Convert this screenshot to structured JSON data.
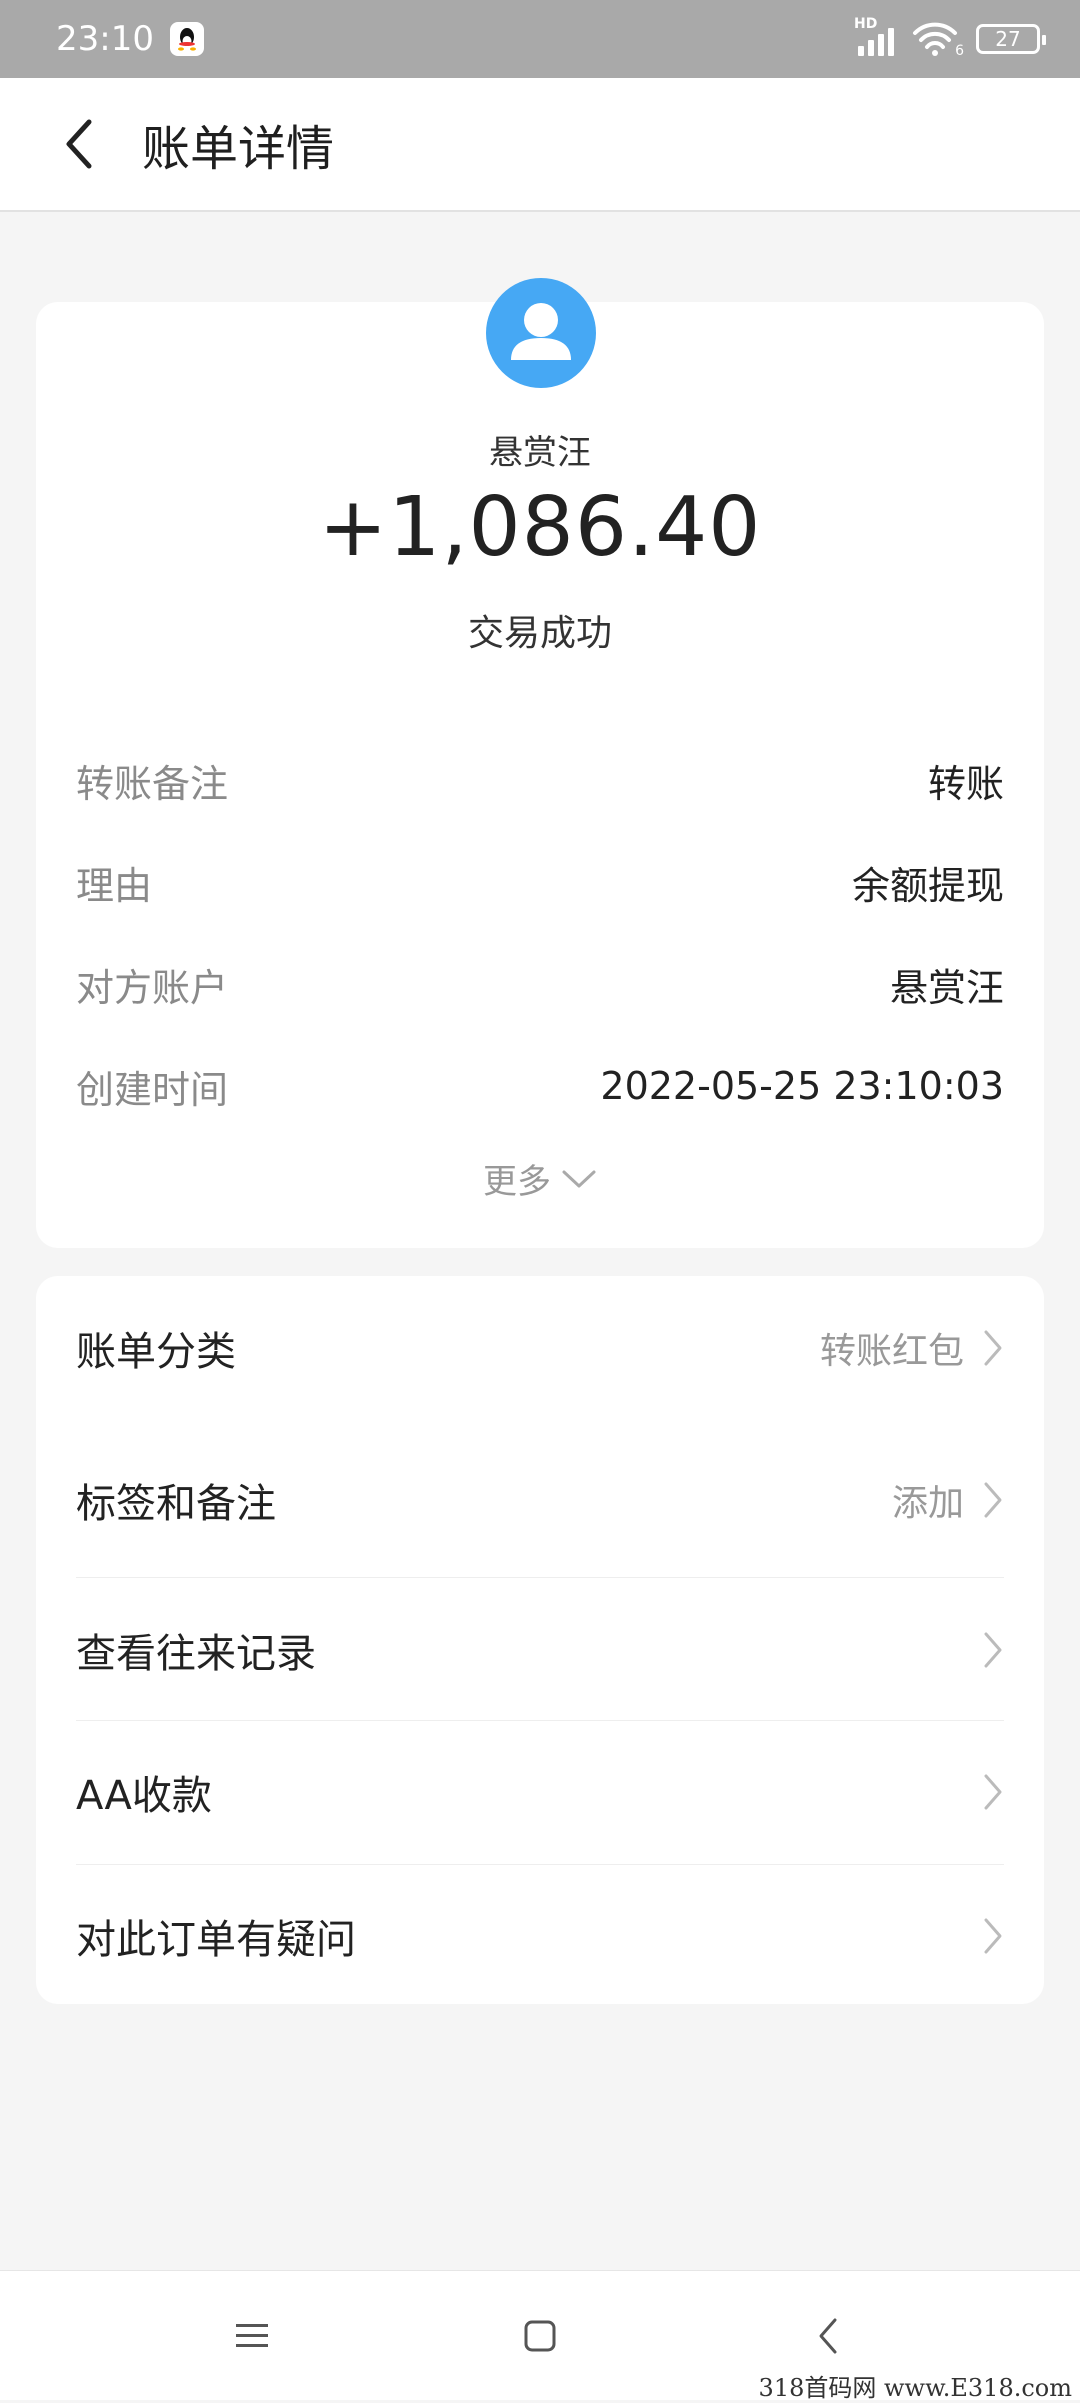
{
  "status_bar": {
    "time": "23:10",
    "network_label": "HD",
    "wifi_sub": "6",
    "battery": "27"
  },
  "header": {
    "title": "账单详情"
  },
  "summary": {
    "payee": "悬赏汪",
    "amount": "+1,086.40",
    "status": "交易成功"
  },
  "details": [
    {
      "label": "转账备注",
      "value": "转账"
    },
    {
      "label": "理由",
      "value": "余额提现"
    },
    {
      "label": "对方账户",
      "value": "悬赏汪"
    },
    {
      "label": "创建时间",
      "value": "2022-05-25 23:10:03"
    }
  ],
  "more_label": "更多",
  "menu": [
    {
      "label": "账单分类",
      "value": "转账红包"
    },
    {
      "label": "标签和备注",
      "value": "添加"
    },
    {
      "label": "查看往来记录",
      "value": ""
    },
    {
      "label": "AA收款",
      "value": ""
    },
    {
      "label": "对此订单有疑问",
      "value": ""
    }
  ],
  "colors": {
    "avatar_bg": "#46a8f4",
    "status_bar_bg": "#a9a9a9",
    "page_bg": "#f5f5f5"
  },
  "icons": [
    "qq-icon",
    "signal-icon",
    "wifi-icon",
    "battery-icon",
    "back-arrow-icon",
    "user-avatar-icon",
    "chevron-down-icon",
    "chevron-right-icon",
    "menu-icon",
    "home-icon",
    "back-icon"
  ],
  "watermark": "318首码网 www.E318.com"
}
